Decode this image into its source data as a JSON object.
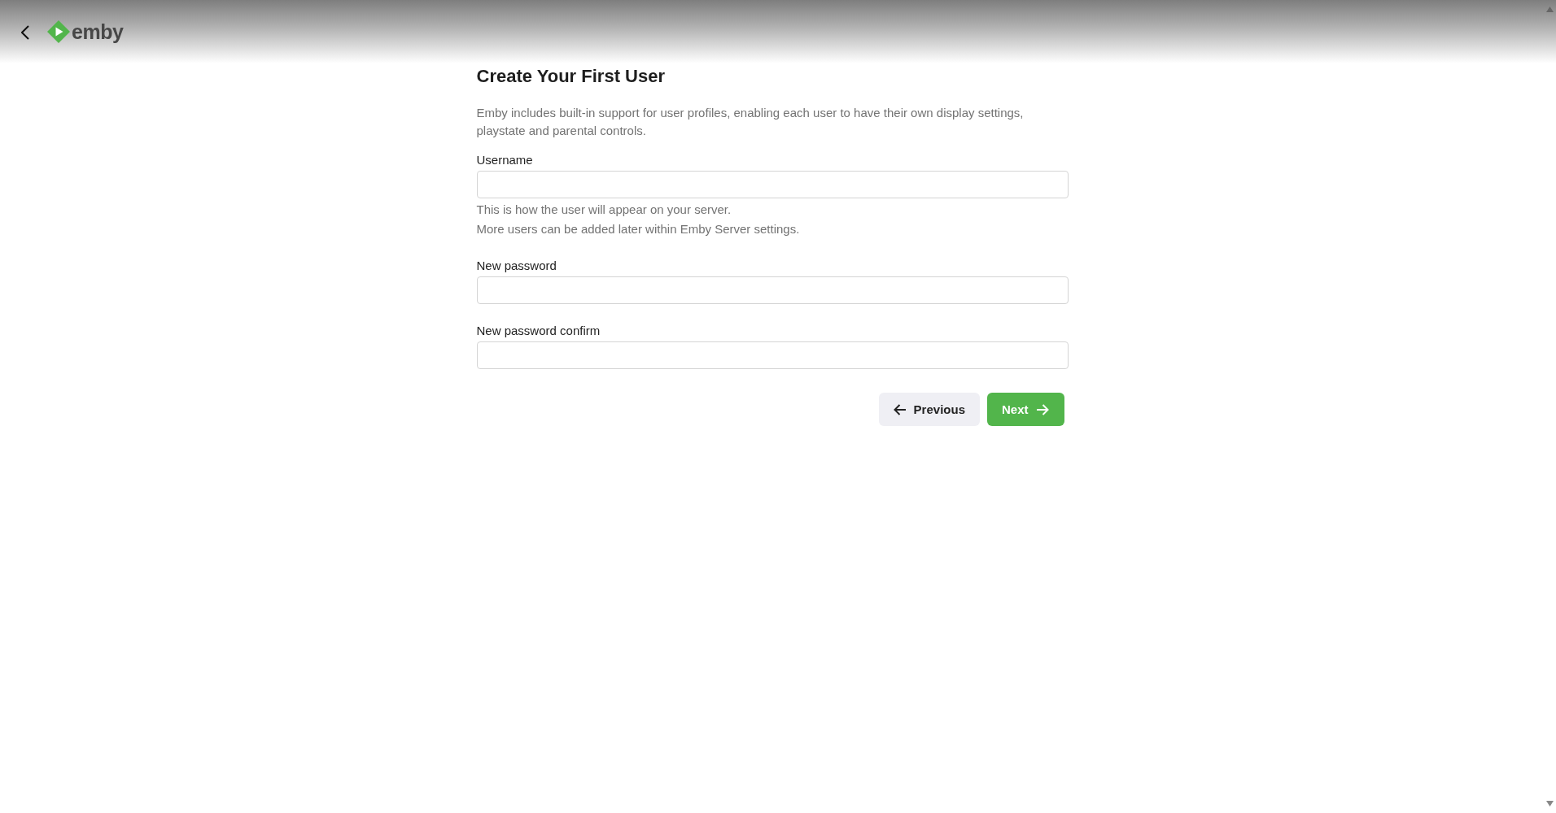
{
  "header": {
    "logo_text": "emby"
  },
  "page": {
    "title": "Create Your First User",
    "description": "Emby includes built-in support for user profiles, enabling each user to have their own display settings, playstate and parental controls."
  },
  "fields": [
    {
      "label": "Username",
      "help": [
        "This is how the user will appear on your server.",
        "More users can be added later within Emby Server settings."
      ]
    },
    {
      "label": "New password"
    },
    {
      "label": "New password confirm"
    }
  ],
  "buttons": [
    {
      "label": "Previous",
      "kind": "secondary"
    },
    {
      "label": "Next",
      "kind": "primary"
    }
  ]
}
